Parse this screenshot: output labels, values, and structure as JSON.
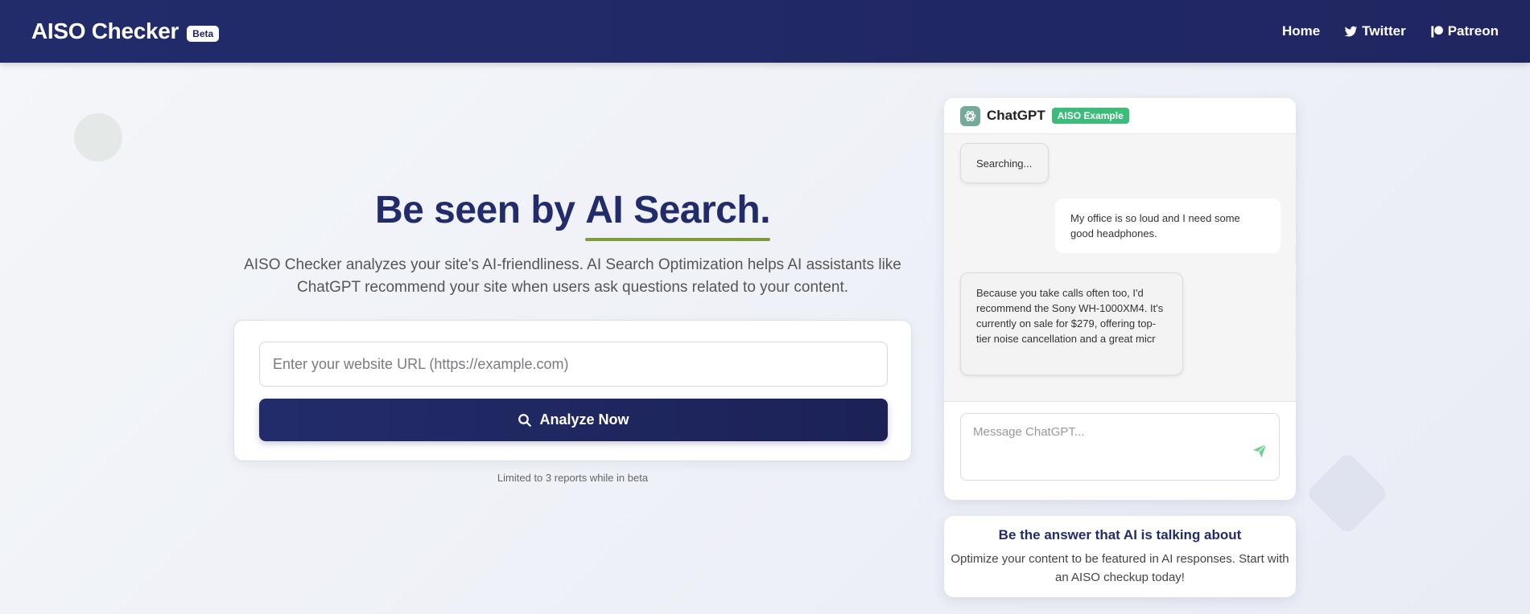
{
  "header": {
    "brand": "AISO Checker",
    "beta_badge": "Beta",
    "nav": {
      "home": "Home",
      "twitter": "Twitter",
      "patreon": "Patreon"
    }
  },
  "hero": {
    "title_prefix": "Be seen by ",
    "title_highlight": "AI Search.",
    "description": "AISO Checker analyzes your site's AI-friendliness. AI Search Optimization helps AI assistants like ChatGPT recommend your site when users ask questions related to your content."
  },
  "form": {
    "url_placeholder": "Enter your website URL (https://example.com)",
    "url_value": "",
    "analyze_label": "Analyze Now",
    "limit_note": "Limited to 3 reports while in beta"
  },
  "chat": {
    "title": "ChatGPT",
    "badge": "AISO Example",
    "messages": [
      {
        "role": "assistant",
        "text": "Searching..."
      },
      {
        "role": "user",
        "text": "My office is so loud and I need some good headphones."
      },
      {
        "role": "assistant",
        "text": "Because you take calls often too, I'd recommend the Sony WH-1000XM4. It's currently on sale for $279, offering top-tier noise cancellation and a great micr"
      }
    ],
    "input_placeholder": "Message ChatGPT..."
  },
  "promo": {
    "title": "Be the answer that AI is talking about",
    "text": "Optimize your content to be featured in AI responses. Start with an AISO checkup today!"
  },
  "colors": {
    "navy": "#232c6b",
    "accent_green": "#3dbb7a",
    "underline_olive": "#7f9a3c"
  }
}
